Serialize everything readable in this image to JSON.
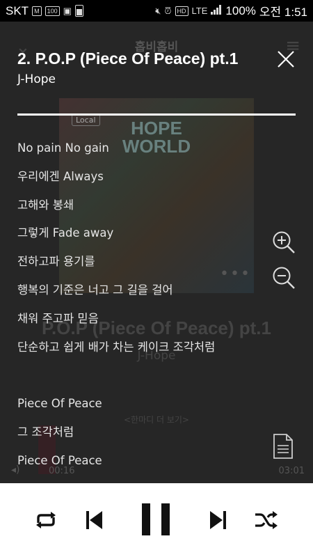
{
  "status_bar": {
    "carrier": "SKT",
    "badge": "100",
    "network": "LTE",
    "battery": "100%",
    "time": "오전 1:51"
  },
  "background": {
    "artist_header": "홉비홉비",
    "local_badge": "Local",
    "album_art_text": "HOPE WORLD",
    "song_title": "P.O.P (Piece Of Peace) pt.1",
    "song_artist": "J-Hope",
    "lyric_hint": "<한마디 더 보기>",
    "elapsed": "00:16",
    "duration": "03:01"
  },
  "lyrics_panel": {
    "title": "2. P.O.P (Piece Of Peace) pt.1",
    "artist": "J-Hope",
    "lines": [
      "No pain No gain",
      "우리에겐 Always",
      "고해와 봉쇄",
      "그렇게 Fade away",
      "전하고파 용기를",
      "행복의 기준은 너고 그 길을 걸어",
      "채워 주고파 믿음",
      "단순하고 쉽게 배가 차는 케이크 조각처럼",
      "",
      "Piece Of Peace",
      "그 조각처럼",
      "Piece Of Peace"
    ]
  },
  "icons": {
    "close": "close-icon",
    "zoom_in": "zoom-in-icon",
    "zoom_out": "zoom-out-icon",
    "lyrics_doc": "document-icon",
    "repeat": "repeat-icon",
    "previous": "previous-track-icon",
    "pause": "pause-icon",
    "next": "next-track-icon",
    "shuffle": "shuffle-icon"
  },
  "colors": {
    "overlay_bg": "#1b1b1b",
    "text": "#ffffff",
    "controls_bg": "#ffffff",
    "controls_icon": "#111111"
  }
}
